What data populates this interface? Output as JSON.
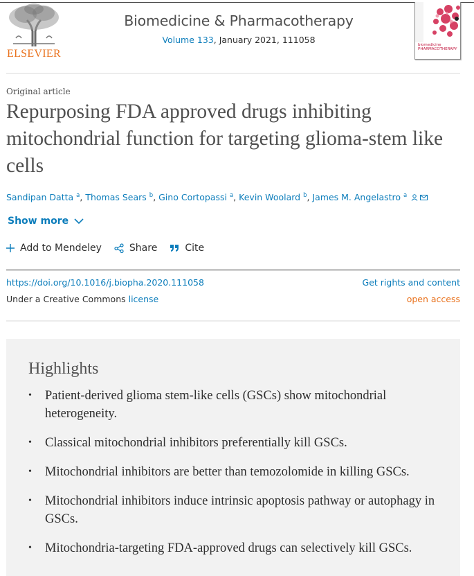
{
  "publisher": {
    "logo_text": "ELSEVIER"
  },
  "journal": {
    "title": "Biomedicine & Pharmacotherapy",
    "volume_link": "Volume 133",
    "issue_info": ", January 2021, 111058",
    "cover_text_1": "biomedicine",
    "cover_text_2": "PHARMACOTHERAPY"
  },
  "article": {
    "type": "Original article",
    "title": "Repurposing FDA approved drugs inhibiting mitochondrial function for targeting glioma-stem like cells",
    "authors": [
      {
        "name": "Sandipan Datta",
        "aff": "a"
      },
      {
        "name": "Thomas Sears",
        "aff": "b"
      },
      {
        "name": "Gino Cortopassi",
        "aff": "a"
      },
      {
        "name": "Kevin Woolard",
        "aff": "b"
      },
      {
        "name": "James M. Angelastro",
        "aff": "a"
      }
    ],
    "show_more": "Show more"
  },
  "actions": {
    "mendeley": "Add to Mendeley",
    "share": "Share",
    "cite": "Cite"
  },
  "links": {
    "doi": "https://doi.org/10.1016/j.biopha.2020.111058",
    "license_prefix": "Under a Creative Commons ",
    "license_link": "license",
    "rights": "Get rights and content",
    "access": "open access"
  },
  "highlights": {
    "title": "Highlights",
    "items": [
      "Patient-derived glioma stem-like cells (GSCs) show mitochondrial heterogeneity.",
      "Classical mitochondrial inhibitors preferentially kill GSCs.",
      "Mitochondrial inhibitors are better than temozolomide in killing GSCs.",
      "Mitochondrial inhibitors induce intrinsic apoptosis pathway or autophagy in GSCs.",
      "Mitochondria-targeting FDA-approved drugs can selectively kill GSCs."
    ]
  },
  "colors": {
    "link": "#0c7dbb",
    "accent": "#e9711c",
    "text": "#2e2e2e",
    "panel": "#f2f2f2"
  }
}
